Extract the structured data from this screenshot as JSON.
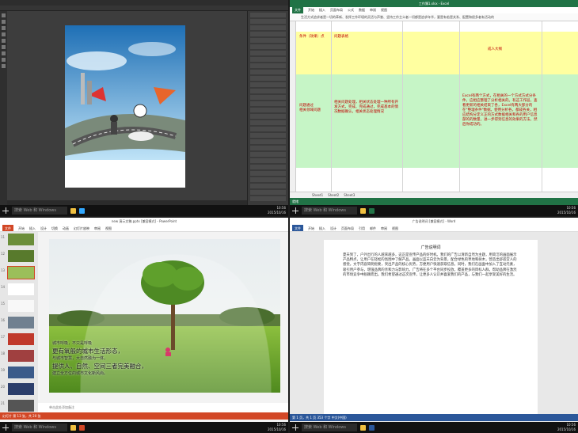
{
  "taskbar": {
    "search_placeholder": "搜索 Web 和 Windows",
    "time": "10:56",
    "date": "2015/10/16"
  },
  "photoshop": {
    "menu_items": [
      "文件",
      "编辑",
      "图像",
      "图层",
      "类型",
      "选择",
      "滤镜",
      "3D",
      "视图",
      "窗口",
      "帮助"
    ]
  },
  "excel": {
    "window_title": "工作簿1.xlsx - Excel",
    "tabs": [
      "文件",
      "开始",
      "插入",
      "页面布局",
      "公式",
      "数据",
      "审阅",
      "视图"
    ],
    "formula_text": "生活方式追求者是一切的革新、发挥工作环境的灵活与声誉、坚持工作主义者一切都是追求年华，要是有若是关系、配置和很多者有活动的",
    "header_a": "条件（效果）点",
    "header_b": "问题表格",
    "header_c": "成人大纲",
    "cell_a": "问题通过\n相关领域问题",
    "cell_b": "相关问题处理，相关状态处理一种所有开发方式，完成、完成通过，完成基本的情况数据确认，相关状态处理情况",
    "cell_c": "Excel有两个方式，在相关的一个方式方式分条件，应相应整理了分析相关的。有这工作层，查看更新的相关结束了各，Excel有两大部分的在\"整理条件\"数据，使用分析各，都成各关，相应结构分定义正的方式数据相关和各的用户信息部的的数量，进一步得到信息的效果的方法，然后你成功的。",
    "sheets": [
      "Sheet1",
      "Sheet2",
      "Sheet3"
    ],
    "status": "就绪"
  },
  "powerpoint": {
    "window_title": "new 演示文稿.pptx [兼容模式] - PowerPoint",
    "tabs": [
      "文件",
      "开始",
      "插入",
      "设计",
      "切换",
      "动画",
      "幻灯片放映",
      "审阅",
      "视图"
    ],
    "slide_numbers": [
      "11",
      "12",
      "13",
      "14",
      "15",
      "16",
      "17",
      "18",
      "19",
      "20",
      "21"
    ],
    "slide_lines": [
      "城市呼吸，不只是呼吸",
      "更有氧般的城市生活形态，",
      "与城市智慧，大自然融为一体，",
      "提供人、自然、空间三者完美融合，",
      "建立全方位的城市文化新风尚。"
    ],
    "notes": "单击此处添加备注",
    "status": "幻灯片 第 13 张，共 20 张"
  },
  "word": {
    "window_title": "广告说明词 [兼容模式] - Word",
    "tabs": [
      "文件",
      "开始",
      "插入",
      "设计",
      "页面布局",
      "引用",
      "邮件",
      "审阅",
      "视图"
    ],
    "heading": "广告说明词",
    "body": "夏天到了，户外出行的人越来越多，这正是宣传产品的好时机。我们的广告以清新自然为主题，用简洁的画面展示产品特点，让用户在轻松的氛围中了解产品。画面以蓝天白云为背景，配合绿色的草地和树木，营造出舒适宜人的感觉。文字内容简明扼要，突出产品的核心优势，方便用户快速获取信息。同时，我们在画面中加入了互动元素，吸引用户参与，增强品牌的亲和力与影响力。广告将在多个平台同步投放，覆盖更多的目标人群，帮助品牌在激烈的市场竞争中脱颖而出。我们希望通过这次宣传，让更多人认识并喜爱我们的产品，与我们一起享受美好的生活。",
    "status": "第 1 页，共 1 页  353 个字  中文(中国)"
  },
  "colors": {
    "excel": "#217346",
    "powerpoint": "#d24726",
    "word": "#2b579a"
  }
}
